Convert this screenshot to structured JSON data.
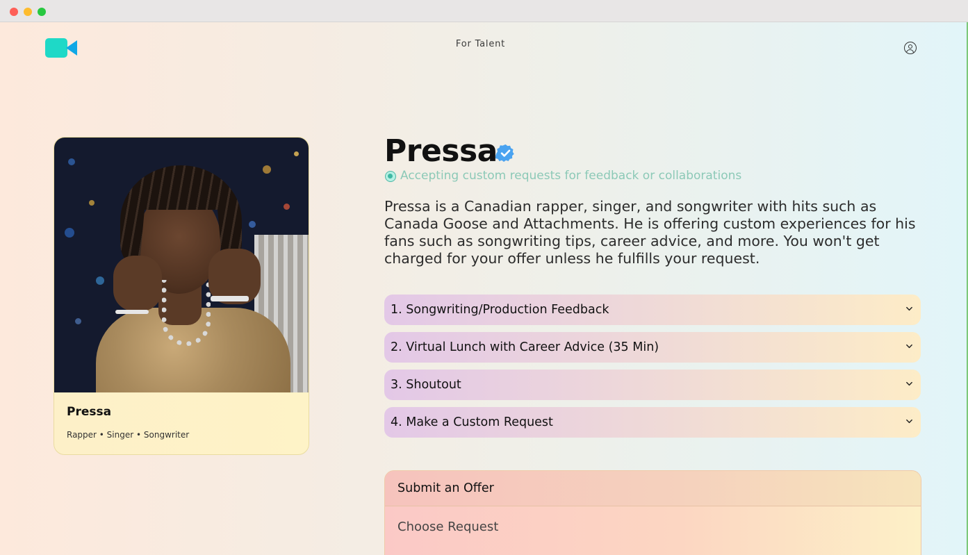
{
  "window": {
    "controls": [
      "close",
      "minimize",
      "maximize"
    ]
  },
  "nav": {
    "logo_icon": "video-camera-icon",
    "for_talent": "For Talent",
    "account_icon": "user-circle-icon"
  },
  "profile_card": {
    "name": "Pressa",
    "roles": "Rapper • Singer • Songwriter"
  },
  "artist": {
    "name": "Pressa",
    "verified_icon": "verified-badge-icon",
    "status": "Accepting custom requests for feedback or collaborations",
    "bio": "Pressa is a Canadian rapper, singer, and songwriter with hits such as Canada Goose and Attachments. He is offering custom experiences for his fans such as songwriting tips, career advice, and more. You won't get charged for your offer unless he fulfills your request."
  },
  "offerings": [
    {
      "label": "1. Songwriting/Production Feedback"
    },
    {
      "label": "2. Virtual Lunch with Career Advice (35 Min)"
    },
    {
      "label": "3. Shoutout"
    },
    {
      "label": "4. Make a Custom Request"
    }
  ],
  "submit": {
    "title": "Submit an Offer",
    "choose_request": "Choose Request"
  },
  "colors": {
    "brand_teal": "#1ed9c7",
    "brand_blue": "#10a8e6",
    "verified_blue": "#4aa3f0",
    "status_green": "#8cc9b7"
  }
}
